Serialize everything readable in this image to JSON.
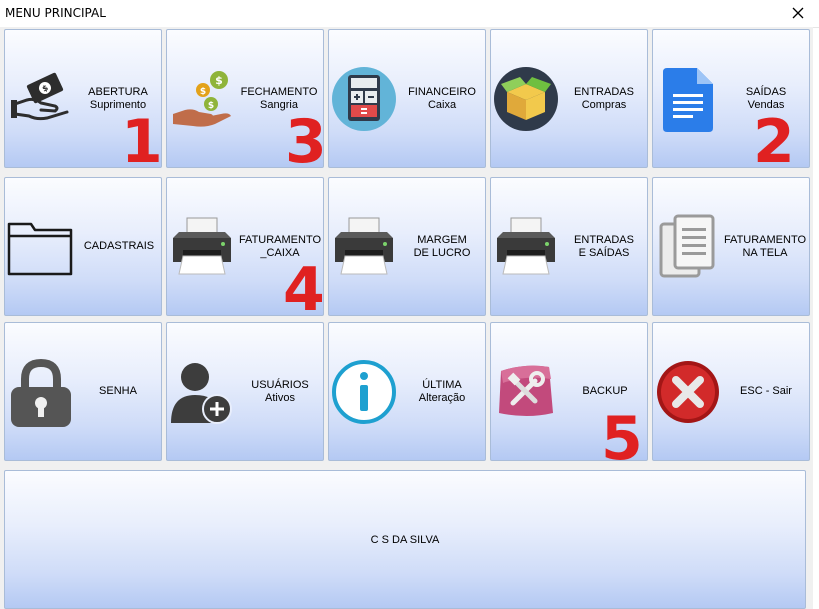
{
  "window": {
    "title": "MENU PRINCIPAL",
    "close_icon": "close-x"
  },
  "buttons": {
    "abertura": {
      "line1": "ABERTURA",
      "line2": "Suprimento",
      "badge": "1",
      "icon": "hand-money"
    },
    "fechamento": {
      "line1": "FECHAMENTO",
      "line2": "Sangria",
      "badge": "3",
      "icon": "hand-coins"
    },
    "financeiro": {
      "line1": "FINANCEIRO",
      "line2": "Caixa",
      "icon": "calculator"
    },
    "entradas": {
      "line1": "ENTRADAS",
      "line2": "Compras",
      "icon": "open-box"
    },
    "saidas": {
      "line1": "SAÍDAS",
      "line2": "Vendas",
      "badge": "2",
      "icon": "document"
    },
    "cadastrais": {
      "line1": "CADASTRAIS",
      "icon": "folder"
    },
    "faturamento_caixa": {
      "line1": "FATURAMENTO",
      "line2": "_CAIXA",
      "badge": "4",
      "icon": "printer"
    },
    "margem_lucro": {
      "line1": "MARGEM",
      "line2": "DE LUCRO",
      "icon": "printer"
    },
    "entradas_saidas": {
      "line1": "ENTRADAS",
      "line2": "E SAÍDAS",
      "icon": "printer"
    },
    "faturamento_tela": {
      "line1": "FATURAMENTO",
      "line2": "NA TELA",
      "icon": "copy-pages"
    },
    "senha": {
      "line1": "SENHA",
      "icon": "lock"
    },
    "usuarios": {
      "line1": "USUÁRIOS",
      "line2": "Ativos",
      "icon": "add-user"
    },
    "ultima": {
      "line1": "ÚLTIMA",
      "line2": "Alteração",
      "icon": "info"
    },
    "backup": {
      "line1": "BACKUP",
      "badge": "5",
      "icon": "tools"
    },
    "sair": {
      "line1": "ESC - Sair",
      "icon": "close-circle"
    }
  },
  "footer": {
    "text": "C S DA SILVA"
  },
  "colors": {
    "badge": "#e02121",
    "button_top": "#fbfcff",
    "button_bottom": "#b4c9f3",
    "border": "#a9bcd8"
  }
}
